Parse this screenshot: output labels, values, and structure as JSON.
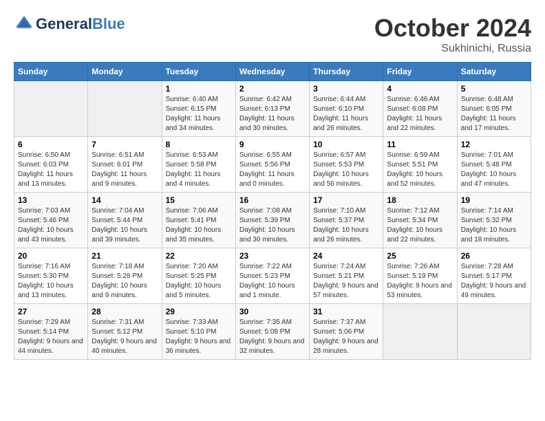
{
  "header": {
    "logo_general": "General",
    "logo_blue": "Blue",
    "month_title": "October 2024",
    "location": "Sukhinichi, Russia"
  },
  "weekdays": [
    "Sunday",
    "Monday",
    "Tuesday",
    "Wednesday",
    "Thursday",
    "Friday",
    "Saturday"
  ],
  "weeks": [
    [
      {
        "day": "",
        "sunrise": "",
        "sunset": "",
        "daylight": ""
      },
      {
        "day": "",
        "sunrise": "",
        "sunset": "",
        "daylight": ""
      },
      {
        "day": "1",
        "sunrise": "Sunrise: 6:40 AM",
        "sunset": "Sunset: 6:15 PM",
        "daylight": "Daylight: 11 hours and 34 minutes."
      },
      {
        "day": "2",
        "sunrise": "Sunrise: 6:42 AM",
        "sunset": "Sunset: 6:13 PM",
        "daylight": "Daylight: 11 hours and 30 minutes."
      },
      {
        "day": "3",
        "sunrise": "Sunrise: 6:44 AM",
        "sunset": "Sunset: 6:10 PM",
        "daylight": "Daylight: 11 hours and 26 minutes."
      },
      {
        "day": "4",
        "sunrise": "Sunrise: 6:46 AM",
        "sunset": "Sunset: 6:08 PM",
        "daylight": "Daylight: 11 hours and 22 minutes."
      },
      {
        "day": "5",
        "sunrise": "Sunrise: 6:48 AM",
        "sunset": "Sunset: 6:05 PM",
        "daylight": "Daylight: 11 hours and 17 minutes."
      }
    ],
    [
      {
        "day": "6",
        "sunrise": "Sunrise: 6:50 AM",
        "sunset": "Sunset: 6:03 PM",
        "daylight": "Daylight: 11 hours and 13 minutes."
      },
      {
        "day": "7",
        "sunrise": "Sunrise: 6:51 AM",
        "sunset": "Sunset: 6:01 PM",
        "daylight": "Daylight: 11 hours and 9 minutes."
      },
      {
        "day": "8",
        "sunrise": "Sunrise: 6:53 AM",
        "sunset": "Sunset: 5:58 PM",
        "daylight": "Daylight: 11 hours and 4 minutes."
      },
      {
        "day": "9",
        "sunrise": "Sunrise: 6:55 AM",
        "sunset": "Sunset: 5:56 PM",
        "daylight": "Daylight: 11 hours and 0 minutes."
      },
      {
        "day": "10",
        "sunrise": "Sunrise: 6:57 AM",
        "sunset": "Sunset: 5:53 PM",
        "daylight": "Daylight: 10 hours and 56 minutes."
      },
      {
        "day": "11",
        "sunrise": "Sunrise: 6:59 AM",
        "sunset": "Sunset: 5:51 PM",
        "daylight": "Daylight: 10 hours and 52 minutes."
      },
      {
        "day": "12",
        "sunrise": "Sunrise: 7:01 AM",
        "sunset": "Sunset: 5:48 PM",
        "daylight": "Daylight: 10 hours and 47 minutes."
      }
    ],
    [
      {
        "day": "13",
        "sunrise": "Sunrise: 7:03 AM",
        "sunset": "Sunset: 5:46 PM",
        "daylight": "Daylight: 10 hours and 43 minutes."
      },
      {
        "day": "14",
        "sunrise": "Sunrise: 7:04 AM",
        "sunset": "Sunset: 5:44 PM",
        "daylight": "Daylight: 10 hours and 39 minutes."
      },
      {
        "day": "15",
        "sunrise": "Sunrise: 7:06 AM",
        "sunset": "Sunset: 5:41 PM",
        "daylight": "Daylight: 10 hours and 35 minutes."
      },
      {
        "day": "16",
        "sunrise": "Sunrise: 7:08 AM",
        "sunset": "Sunset: 5:39 PM",
        "daylight": "Daylight: 10 hours and 30 minutes."
      },
      {
        "day": "17",
        "sunrise": "Sunrise: 7:10 AM",
        "sunset": "Sunset: 5:37 PM",
        "daylight": "Daylight: 10 hours and 26 minutes."
      },
      {
        "day": "18",
        "sunrise": "Sunrise: 7:12 AM",
        "sunset": "Sunset: 5:34 PM",
        "daylight": "Daylight: 10 hours and 22 minutes."
      },
      {
        "day": "19",
        "sunrise": "Sunrise: 7:14 AM",
        "sunset": "Sunset: 5:32 PM",
        "daylight": "Daylight: 10 hours and 18 minutes."
      }
    ],
    [
      {
        "day": "20",
        "sunrise": "Sunrise: 7:16 AM",
        "sunset": "Sunset: 5:30 PM",
        "daylight": "Daylight: 10 hours and 13 minutes."
      },
      {
        "day": "21",
        "sunrise": "Sunrise: 7:18 AM",
        "sunset": "Sunset: 5:28 PM",
        "daylight": "Daylight: 10 hours and 9 minutes."
      },
      {
        "day": "22",
        "sunrise": "Sunrise: 7:20 AM",
        "sunset": "Sunset: 5:25 PM",
        "daylight": "Daylight: 10 hours and 5 minutes."
      },
      {
        "day": "23",
        "sunrise": "Sunrise: 7:22 AM",
        "sunset": "Sunset: 5:23 PM",
        "daylight": "Daylight: 10 hours and 1 minute."
      },
      {
        "day": "24",
        "sunrise": "Sunrise: 7:24 AM",
        "sunset": "Sunset: 5:21 PM",
        "daylight": "Daylight: 9 hours and 57 minutes."
      },
      {
        "day": "25",
        "sunrise": "Sunrise: 7:26 AM",
        "sunset": "Sunset: 5:19 PM",
        "daylight": "Daylight: 9 hours and 53 minutes."
      },
      {
        "day": "26",
        "sunrise": "Sunrise: 7:28 AM",
        "sunset": "Sunset: 5:17 PM",
        "daylight": "Daylight: 9 hours and 49 minutes."
      }
    ],
    [
      {
        "day": "27",
        "sunrise": "Sunrise: 7:29 AM",
        "sunset": "Sunset: 5:14 PM",
        "daylight": "Daylight: 9 hours and 44 minutes."
      },
      {
        "day": "28",
        "sunrise": "Sunrise: 7:31 AM",
        "sunset": "Sunset: 5:12 PM",
        "daylight": "Daylight: 9 hours and 40 minutes."
      },
      {
        "day": "29",
        "sunrise": "Sunrise: 7:33 AM",
        "sunset": "Sunset: 5:10 PM",
        "daylight": "Daylight: 9 hours and 36 minutes."
      },
      {
        "day": "30",
        "sunrise": "Sunrise: 7:35 AM",
        "sunset": "Sunset: 5:08 PM",
        "daylight": "Daylight: 9 hours and 32 minutes."
      },
      {
        "day": "31",
        "sunrise": "Sunrise: 7:37 AM",
        "sunset": "Sunset: 5:06 PM",
        "daylight": "Daylight: 9 hours and 28 minutes."
      },
      {
        "day": "",
        "sunrise": "",
        "sunset": "",
        "daylight": ""
      },
      {
        "day": "",
        "sunrise": "",
        "sunset": "",
        "daylight": ""
      }
    ]
  ]
}
